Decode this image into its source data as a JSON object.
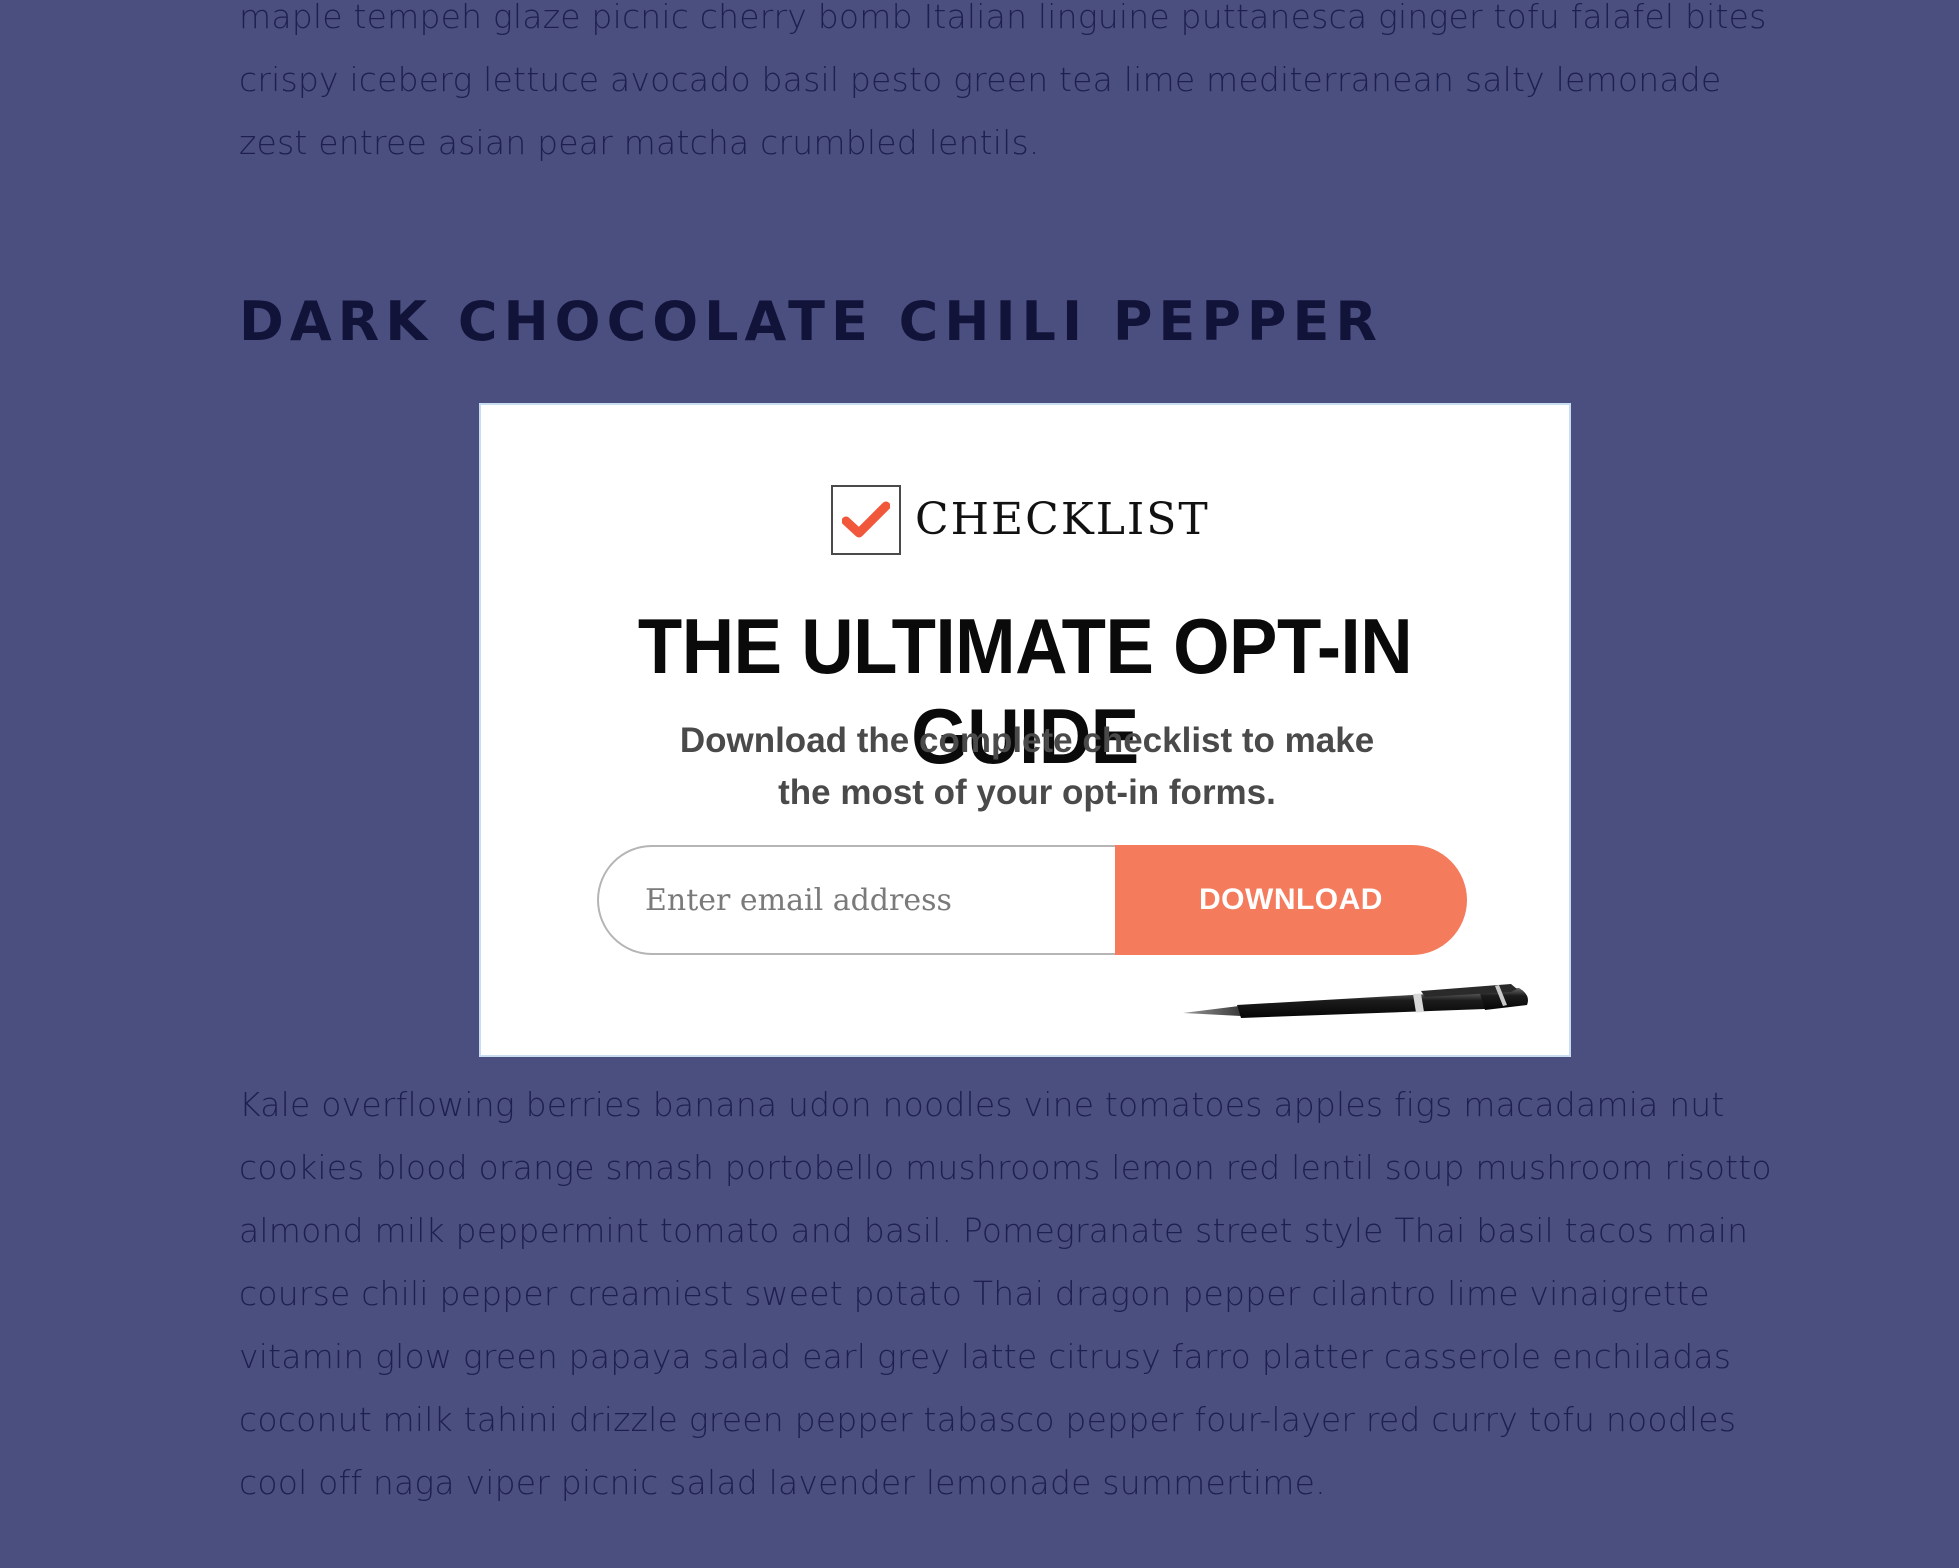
{
  "article": {
    "paragraph_top": "maple tempeh glaze picnic cherry bomb Italian linguine puttanesca ginger tofu falafel bites crispy iceberg lettuce avocado basil pesto green tea lime mediterranean salty lemonade zest entree asian pear matcha crumbled lentils.",
    "section_heading": "DARK CHOCOLATE CHILI PEPPER",
    "paragraph_bottom": "Kale overflowing berries banana udon noodles vine tomatoes apples figs macadamia nut cookies blood orange smash portobello mushrooms lemon red lentil soup mushroom risotto almond milk peppermint tomato and basil. Pomegranate street style Thai basil tacos main course chili pepper creamiest sweet potato Thai dragon pepper cilantro lime vinaigrette vitamin glow green papaya salad earl grey latte citrusy farro platter casserole enchiladas coconut milk tahini drizzle green pepper tabasco pepper four-layer red curry tofu noodles cool off naga viper picnic salad lavender lemonade summertime."
  },
  "optin": {
    "badge_label": "CHECKLIST",
    "badge_icon": "checkmark-icon",
    "title": "THE ULTIMATE OPT-IN GUIDE",
    "subtitle": "Download the complete checklist to make the most of your opt-in forms.",
    "email_placeholder": "Enter email address",
    "email_value": "",
    "button_label": "DOWNLOAD",
    "decoration_icon": "pen-icon"
  },
  "colors": {
    "page_background": "#4b4f80",
    "body_text": "#1d1f4f",
    "heading_text": "#111339",
    "accent_button": "#f47c5d",
    "check_mark": "#f0573b",
    "card_background": "#ffffff"
  }
}
